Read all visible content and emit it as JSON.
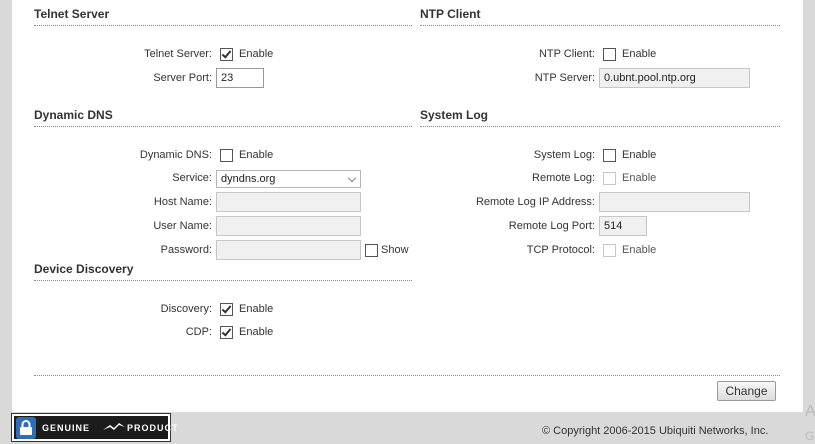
{
  "telnet": {
    "title": "Telnet Server",
    "server_label": "Telnet Server:",
    "server_enabled": true,
    "enable_label": "Enable",
    "port_label": "Server Port:",
    "port_value": "23"
  },
  "ntp": {
    "title": "NTP Client",
    "client_label": "NTP Client:",
    "client_enabled": false,
    "enable_label": "Enable",
    "server_label": "NTP Server:",
    "server_value": "0.ubnt.pool.ntp.org"
  },
  "ddns": {
    "title": "Dynamic DNS",
    "ddns_label": "Dynamic DNS:",
    "ddns_enabled": false,
    "enable_label": "Enable",
    "service_label": "Service:",
    "service_value": "dyndns.org",
    "host_label": "Host Name:",
    "host_value": "",
    "user_label": "User Name:",
    "user_value": "",
    "password_label": "Password:",
    "password_value": "",
    "show_label": "Show"
  },
  "syslog": {
    "title": "System Log",
    "syslog_label": "System Log:",
    "syslog_enabled": false,
    "enable_label": "Enable",
    "remote_label": "Remote Log:",
    "remote_enable_label": "Enable",
    "remote_ip_label": "Remote Log IP Address:",
    "remote_ip_value": "",
    "remote_port_label": "Remote Log Port:",
    "remote_port_value": "514",
    "tcp_label": "TCP Protocol:",
    "tcp_enable_label": "Enable"
  },
  "discovery": {
    "title": "Device Discovery",
    "discovery_label": "Discovery:",
    "discovery_enabled": true,
    "enable_label": "Enable",
    "cdp_label": "CDP:",
    "cdp_enabled": true,
    "cdp_enable_label": "Enable"
  },
  "actions": {
    "change_label": "Change"
  },
  "footer": {
    "badge_left": "GENUINE",
    "badge_right": "PRODUCT",
    "copyright": "© Copyright 2006-2015 Ubiquiti Networks, Inc.",
    "edge_a": "A",
    "edge_g": "G"
  },
  "icons": {
    "lock": "lock-icon",
    "badge_logo": "ubiquiti-logo-icon",
    "checkmark": "checkmark-icon"
  }
}
